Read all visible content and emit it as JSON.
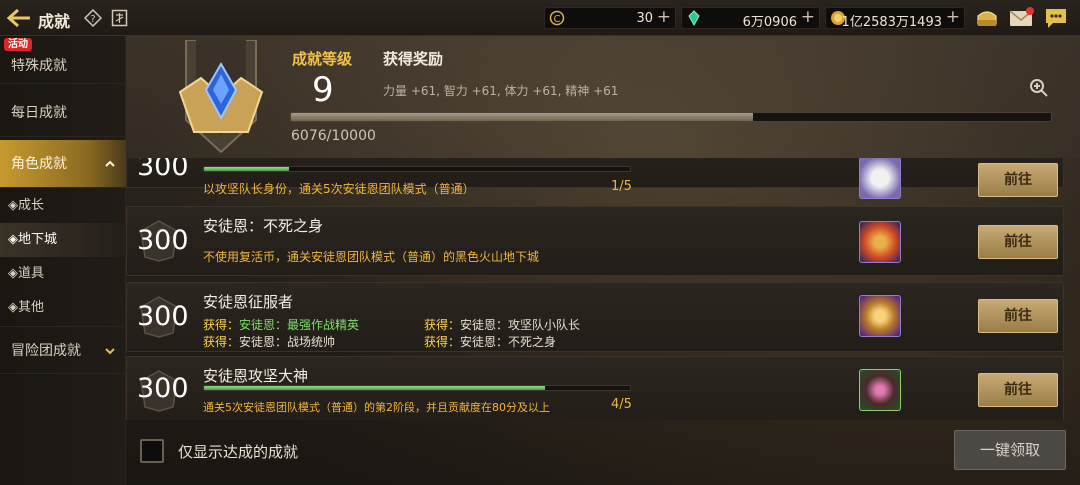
{
  "window": {
    "title": "成就"
  },
  "resources": [
    {
      "name": "coin",
      "value": "30"
    },
    {
      "name": "gem",
      "value": "6万0906"
    },
    {
      "name": "gold",
      "value": "1亿2583万1493"
    }
  ],
  "sidebar": {
    "event_badge": "活动",
    "items": [
      "特殊成就",
      "每日成就",
      "角色成就"
    ],
    "subitems": [
      "成长",
      "地下城",
      "道具",
      "其他"
    ],
    "guild": "冒险团成就"
  },
  "header": {
    "level_label": "成就等级",
    "level": "9",
    "reward_label": "获得奖励",
    "reward_text": "力量 +61, 智力 +61, 体力 +61, 精神 +61",
    "xp_text": "6076/10000",
    "xp_ratio": 0.6076
  },
  "achievements": [
    {
      "points": "300",
      "title": "",
      "desc": "以攻坚队长身份，通关5次安徒恩团队模式（普通）",
      "progress": "1/5",
      "ratio": 0.2,
      "go": "前往"
    },
    {
      "points": "300",
      "title": "安徒恩：不死之身",
      "desc": "不使用复活币，通关安徒恩团队模式（普通）的黑色火山地下城",
      "go": "前往"
    },
    {
      "points": "300",
      "title": "安徒恩征服者",
      "rewards": [
        {
          "prefix": "获得：",
          "label": "安徒恩：",
          "value": "最强作战精英"
        },
        {
          "prefix": "获得：",
          "label": "安徒恩：",
          "value": "攻坚队小队长"
        },
        {
          "prefix": "获得：",
          "label": "安徒恩：",
          "value": "战场统帅"
        },
        {
          "prefix": "获得：",
          "label": "安徒恩：",
          "value": "不死之身"
        }
      ],
      "go": "前往"
    },
    {
      "points": "300",
      "title": "安徒恩攻坚大神",
      "desc": "通关5次安徒恩团队模式（普通）的第2阶段，并且贡献度在80分及以上",
      "progress": "4/5",
      "ratio": 0.8,
      "go": "前往"
    }
  ],
  "footer": {
    "checkbox_label": "仅显示达成的成就",
    "claim_all": "一键领取"
  }
}
